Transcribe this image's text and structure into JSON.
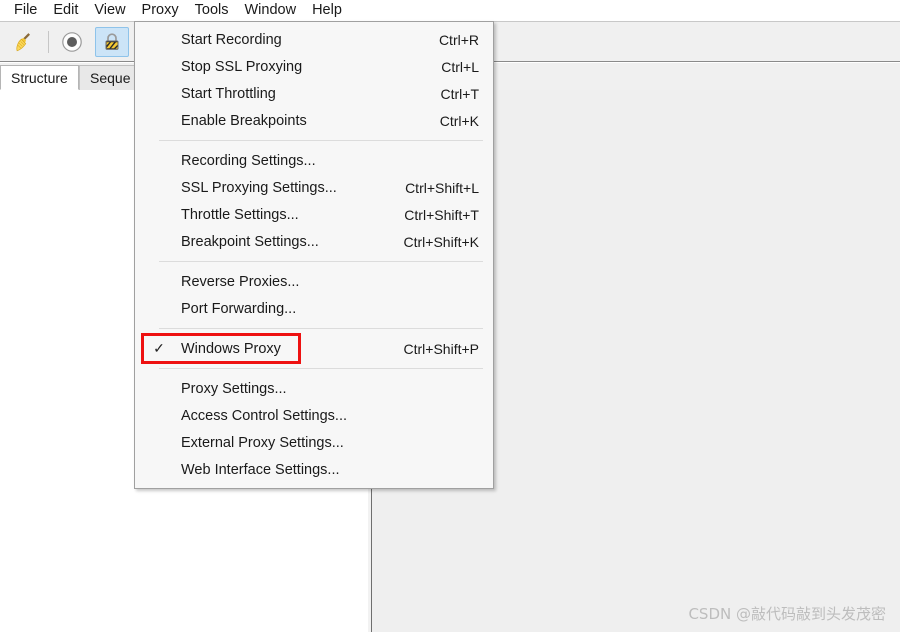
{
  "app": {
    "window_background": "#ffffff",
    "panel_background": "#efefef",
    "menu_background": "#f7f7f7",
    "accent_highlight": "#cce4f7",
    "annotation_color": "#ee1111"
  },
  "menubar": {
    "items": [
      {
        "label": "File",
        "open": false
      },
      {
        "label": "Edit",
        "open": false
      },
      {
        "label": "View",
        "open": false
      },
      {
        "label": "Proxy",
        "open": true
      },
      {
        "label": "Tools",
        "open": false
      },
      {
        "label": "Window",
        "open": false
      },
      {
        "label": "Help",
        "open": false
      }
    ]
  },
  "toolbar": {
    "buttons": [
      {
        "name": "clear-broom-icon",
        "active": false
      },
      {
        "name": "record-icon",
        "active": false
      },
      {
        "name": "ssl-lock-icon",
        "active": true
      }
    ]
  },
  "tabs": [
    {
      "label": "Structure",
      "selected": true
    },
    {
      "label": "Seque",
      "selected": false
    }
  ],
  "proxy_menu": {
    "title": "Proxy",
    "groups": [
      {
        "items": [
          {
            "label": "Start Recording",
            "shortcut": "Ctrl+R",
            "checked": false,
            "highlighted": false
          },
          {
            "label": "Stop SSL Proxying",
            "shortcut": "Ctrl+L",
            "checked": false,
            "highlighted": false
          },
          {
            "label": "Start Throttling",
            "shortcut": "Ctrl+T",
            "checked": false,
            "highlighted": false
          },
          {
            "label": "Enable Breakpoints",
            "shortcut": "Ctrl+K",
            "checked": false,
            "highlighted": false
          }
        ]
      },
      {
        "items": [
          {
            "label": "Recording Settings...",
            "shortcut": "",
            "checked": false,
            "highlighted": false
          },
          {
            "label": "SSL Proxying Settings...",
            "shortcut": "Ctrl+Shift+L",
            "checked": false,
            "highlighted": false
          },
          {
            "label": "Throttle Settings...",
            "shortcut": "Ctrl+Shift+T",
            "checked": false,
            "highlighted": false
          },
          {
            "label": "Breakpoint Settings...",
            "shortcut": "Ctrl+Shift+K",
            "checked": false,
            "highlighted": false
          }
        ]
      },
      {
        "items": [
          {
            "label": "Reverse Proxies...",
            "shortcut": "",
            "checked": false,
            "highlighted": false
          },
          {
            "label": "Port Forwarding...",
            "shortcut": "",
            "checked": false,
            "highlighted": false
          }
        ]
      },
      {
        "items": [
          {
            "label": "Windows Proxy",
            "shortcut": "Ctrl+Shift+P",
            "checked": true,
            "highlighted": true
          }
        ]
      },
      {
        "items": [
          {
            "label": "Proxy Settings...",
            "shortcut": "",
            "checked": false,
            "highlighted": false
          },
          {
            "label": "Access Control Settings...",
            "shortcut": "",
            "checked": false,
            "highlighted": false
          },
          {
            "label": "External Proxy Settings...",
            "shortcut": "",
            "checked": false,
            "highlighted": false
          },
          {
            "label": "Web Interface Settings...",
            "shortcut": "",
            "checked": false,
            "highlighted": false
          }
        ]
      }
    ],
    "check_glyph": "✓"
  },
  "watermark": {
    "text": "CSDN @敲代码敲到头发茂密"
  }
}
